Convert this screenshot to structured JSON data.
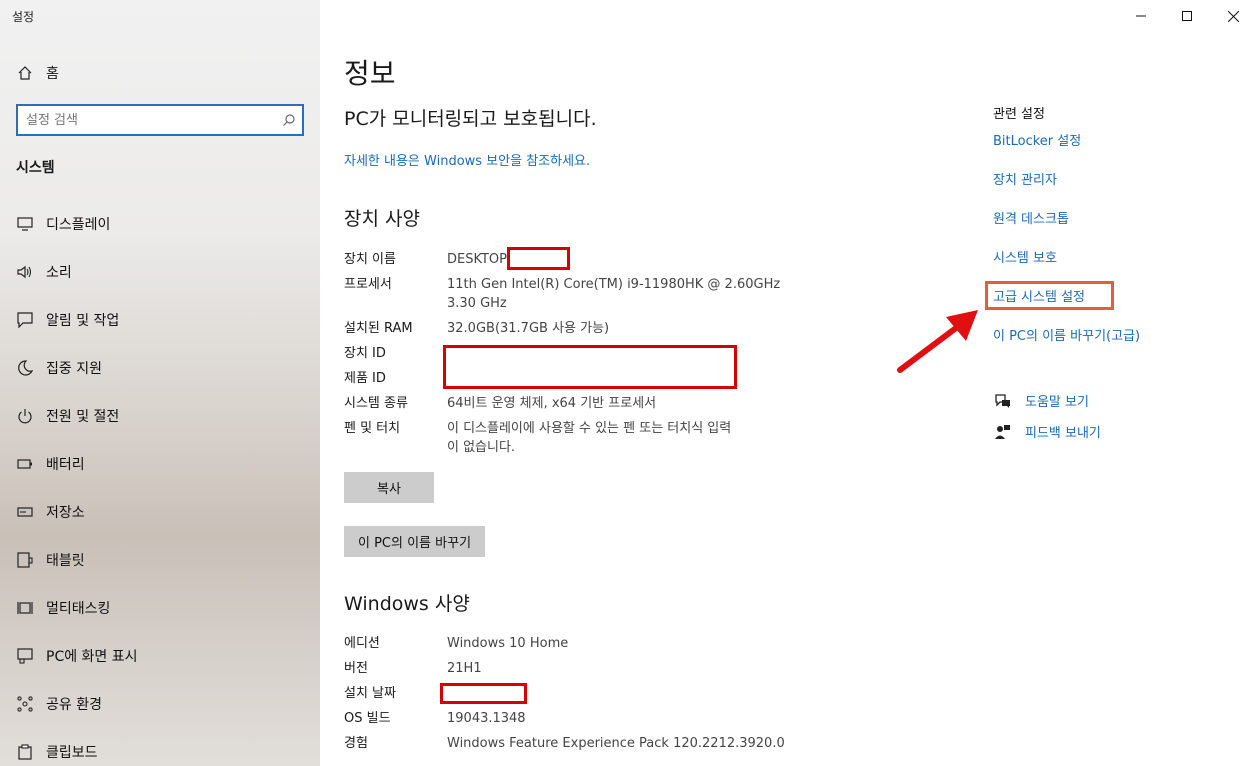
{
  "app": {
    "title": "설정"
  },
  "sidebar": {
    "home_label": "홈",
    "search_placeholder": "설정 검색",
    "section": "시스템",
    "items": [
      {
        "label": "디스플레이",
        "icon": "display-icon"
      },
      {
        "label": "소리",
        "icon": "speaker-icon"
      },
      {
        "label": "알림 및 작업",
        "icon": "notification-icon"
      },
      {
        "label": "집중 지원",
        "icon": "moon-icon"
      },
      {
        "label": "전원 및 절전",
        "icon": "power-icon"
      },
      {
        "label": "배터리",
        "icon": "battery-icon"
      },
      {
        "label": "저장소",
        "icon": "storage-icon"
      },
      {
        "label": "태블릿",
        "icon": "tablet-icon"
      },
      {
        "label": "멀티태스킹",
        "icon": "multitasking-icon"
      },
      {
        "label": "PC에 화면 표시",
        "icon": "project-icon"
      },
      {
        "label": "공유 환경",
        "icon": "share-icon"
      },
      {
        "label": "클립보드",
        "icon": "clipboard-icon"
      }
    ]
  },
  "main": {
    "title": "정보",
    "protect_text": "PC가 모니터링되고 보호됩니다.",
    "security_link": "자세한 내용은 Windows 보안을 참조하세요.",
    "device_spec": {
      "heading": "장치 사양",
      "rows": [
        {
          "key": "장치 이름",
          "value": "DESKTOP"
        },
        {
          "key": "프로세서",
          "value": "11th Gen Intel(R) Core(TM) i9-11980HK @ 2.60GHz",
          "value2": "3.30 GHz"
        },
        {
          "key": "설치된 RAM",
          "value": "32.0GB(31.7GB 사용 가능)"
        },
        {
          "key": "장치 ID",
          "value": ""
        },
        {
          "key": "제품 ID",
          "value": ""
        },
        {
          "key": "시스템 종류",
          "value": "64비트 운영 체제, x64 기반 프로세서"
        },
        {
          "key": "펜 및 터치",
          "value": "이 디스플레이에 사용할 수 있는 펜 또는 터치식 입력",
          "value2": "이 없습니다."
        }
      ],
      "copy_button": "복사",
      "rename_button": "이 PC의 이름 바꾸기"
    },
    "windows_spec": {
      "heading": "Windows 사양",
      "rows": [
        {
          "key": "에디션",
          "value": "Windows 10 Home"
        },
        {
          "key": "버전",
          "value": "21H1"
        },
        {
          "key": "설치 날짜",
          "value": ""
        },
        {
          "key": "OS 빌드",
          "value": "19043.1348"
        },
        {
          "key": "경험",
          "value": "Windows Feature Experience Pack 120.2212.3920.0"
        }
      ]
    }
  },
  "related": {
    "title": "관련 설정",
    "links": [
      "BitLocker 설정",
      "장치 관리자",
      "원격 데스크톱",
      "시스템 보호",
      "고급 시스템 설정",
      "이 PC의 이름 바꾸기(고급)"
    ],
    "help": "도움말 보기",
    "feedback": "피드백 보내기"
  },
  "colors": {
    "link": "#1a6ab8",
    "highlight_box": "#e0603a",
    "redaction_box": "#d70000",
    "arrow": "#e01010"
  }
}
